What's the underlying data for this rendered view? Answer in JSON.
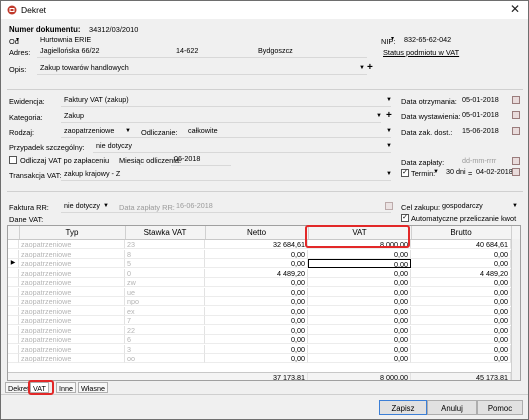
{
  "window": {
    "title": "Dekret",
    "close_glyph": "✕"
  },
  "header": {
    "numer_label": "Numer dokumentu:",
    "numer_value": "34312/03/2010",
    "od_label": "Od",
    "od_value": "Hurtownia ERIE",
    "nip_label": "NIP:",
    "nip_value": "832-65-62-042",
    "adres_label": "Adres:",
    "adres_street": "Jagiellońska 66/22",
    "adres_zip": "14-622",
    "adres_city": "Bydgoszcz",
    "status_vat_link": "Status podmiotu w VAT",
    "opis_label": "Opis:",
    "opis_value": "Zakup towarów handlowych"
  },
  "form": {
    "ewidencja_label": "Ewidencja:",
    "ewidencja_value": "Faktury VAT (zakup)",
    "kategoria_label": "Kategoria:",
    "kategoria_value": "Zakup",
    "rodzaj_label": "Rodzaj:",
    "rodzaj_value": "zaopatrzeniowe",
    "odliczanie_label": "Odliczanie:",
    "odliczanie_value": "całkowite",
    "przypadek_label": "Przypadek szczególny:",
    "przypadek_value": "nie dotyczy",
    "odliczaj_label": "Odliczaj VAT po zapłaceniu",
    "miesiac_label": "Miesiąc odliczenia:",
    "miesiac_value": "06-2018",
    "transakcja_label": "Transakcja VAT:",
    "transakcja_value": "zakup krajowy - Z",
    "faktura_rr_label": "Faktura RR:",
    "faktura_rr_value": "nie dotyczy",
    "data_zaplaty_rr_label": "Data zapłaty RR:",
    "data_zaplaty_rr_value": "16-06-2018",
    "dane_vat_label": "Dane VAT:",
    "data_otrzymania_label": "Data otrzymania:",
    "data_otrzymania_value": "05-01-2018",
    "data_wystawienia_label": "Data wystawienia:",
    "data_wystawienia_value": "05-01-2018",
    "data_zak_label": "Data zak. dost.:",
    "data_zak_value": "15-06-2018",
    "data_zaplaty_label": "Data zapłaty:",
    "data_zaplaty_placeholder": "dd-mm-rrrr",
    "termin_label": "Termin:",
    "termin_days": "30 dni",
    "termin_equals": "=",
    "termin_date": "04-02-2018",
    "cel_zakupu_label": "Cel zakupu:",
    "cel_zakupu_value": "gospodarczy",
    "automatyczne_label": "Automatyczne przeliczanie kwot"
  },
  "table": {
    "columns": [
      "Typ",
      "Stawka VAT",
      "Netto",
      "VAT",
      "Brutto"
    ],
    "current_row_marker": "▶",
    "rows": [
      {
        "typ": "zaopatrzeniowe",
        "stawka": "23",
        "netto": "32 684,61",
        "vat": "8 000,00",
        "brutto": "40 684,61"
      },
      {
        "typ": "zaopatrzeniowe",
        "stawka": "8",
        "netto": "0,00",
        "vat": "0,00",
        "brutto": "0,00"
      },
      {
        "typ": "zaopatrzeniowe",
        "stawka": "5",
        "netto": "0,00",
        "vat": "0,00",
        "brutto": "0,00"
      },
      {
        "typ": "zaopatrzeniowe",
        "stawka": "0",
        "netto": "4 489,20",
        "vat": "0,00",
        "brutto": "4 489,20"
      },
      {
        "typ": "zaopatrzeniowe",
        "stawka": "zw",
        "netto": "0,00",
        "vat": "0,00",
        "brutto": "0,00"
      },
      {
        "typ": "zaopatrzeniowe",
        "stawka": "ue",
        "netto": "0,00",
        "vat": "0,00",
        "brutto": "0,00"
      },
      {
        "typ": "zaopatrzeniowe",
        "stawka": "npo",
        "netto": "0,00",
        "vat": "0,00",
        "brutto": "0,00"
      },
      {
        "typ": "zaopatrzeniowe",
        "stawka": "ex",
        "netto": "0,00",
        "vat": "0,00",
        "brutto": "0,00"
      },
      {
        "typ": "zaopatrzeniowe",
        "stawka": "7",
        "netto": "0,00",
        "vat": "0,00",
        "brutto": "0,00"
      },
      {
        "typ": "zaopatrzeniowe",
        "stawka": "22",
        "netto": "0,00",
        "vat": "0,00",
        "brutto": "0,00"
      },
      {
        "typ": "zaopatrzeniowe",
        "stawka": "6",
        "netto": "0,00",
        "vat": "0,00",
        "brutto": "0,00"
      },
      {
        "typ": "zaopatrzeniowe",
        "stawka": "3",
        "netto": "0,00",
        "vat": "0,00",
        "brutto": "0,00"
      },
      {
        "typ": "zaopatrzeniowe",
        "stawka": "oo",
        "netto": "0,00",
        "vat": "0,00",
        "brutto": "0,00"
      }
    ],
    "totals": {
      "netto": "37 173,81",
      "vat": "8 000,00",
      "brutto": "45 173,81"
    }
  },
  "tabs": [
    "Dekret",
    "VAT",
    "Inne",
    "Własne"
  ],
  "buttons": {
    "zapisz": "Zapisz",
    "anuluj": "Anuluj",
    "pomoc": "Pomoc"
  },
  "colors": {
    "highlight": "#e22828",
    "icon_red": "#c0392b"
  }
}
